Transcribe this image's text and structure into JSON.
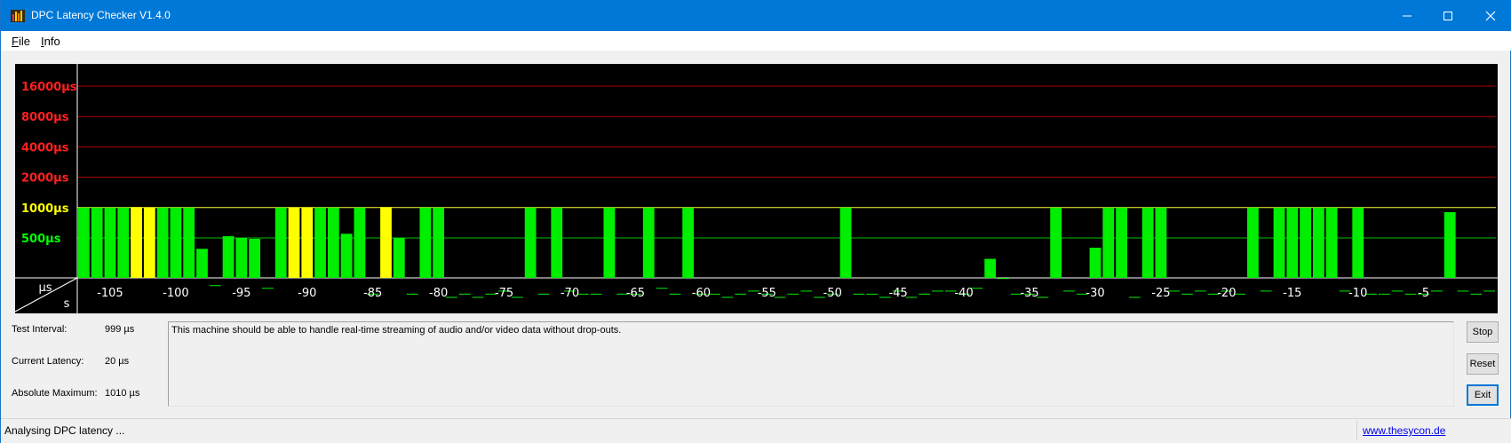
{
  "window": {
    "title": "DPC Latency Checker V1.4.0"
  },
  "menu": {
    "items": [
      {
        "label": "File",
        "accel": "F",
        "rest": "ile"
      },
      {
        "label": "Info",
        "accel": "I",
        "rest": "nfo"
      }
    ]
  },
  "chart_data": {
    "type": "bar",
    "y_scale": "log2",
    "y_ticks": [
      {
        "label": "16000µs",
        "value": 16000,
        "color": "#ff2020"
      },
      {
        "label": "8000µs",
        "value": 8000,
        "color": "#ff2020"
      },
      {
        "label": "4000µs",
        "value": 4000,
        "color": "#ff2020"
      },
      {
        "label": "2000µs",
        "value": 2000,
        "color": "#ff2020"
      },
      {
        "label": "1000µs",
        "value": 1000,
        "color": "#ffff00"
      },
      {
        "label": "500µs",
        "value": 500,
        "color": "#00ff00"
      }
    ],
    "x_label": "s",
    "y_unit_label": "µs",
    "x_ticks": [
      -105,
      -100,
      -95,
      -90,
      -85,
      -80,
      -75,
      -70,
      -65,
      -60,
      -55,
      -50,
      -45,
      -40,
      -35,
      -30,
      -25,
      -20,
      -15,
      -10,
      -5
    ],
    "x_range": [
      -107,
      0
    ],
    "colors": {
      "ok": "#00ee00",
      "warn": "#ffff00",
      "danger": "#ff2020",
      "grid_red": "#b00000",
      "grid_yellow": "#ffff40",
      "grid_green": "#00c000"
    },
    "bars": [
      {
        "t": -107,
        "v": 1000,
        "c": "ok"
      },
      {
        "t": -106,
        "v": 1000,
        "c": "ok"
      },
      {
        "t": -105,
        "v": 1000,
        "c": "ok"
      },
      {
        "t": -104,
        "v": 1000,
        "c": "ok"
      },
      {
        "t": -103,
        "v": 1010,
        "c": "warn"
      },
      {
        "t": -102,
        "v": 1005,
        "c": "warn"
      },
      {
        "t": -101,
        "v": 1000,
        "c": "ok"
      },
      {
        "t": -100,
        "v": 1000,
        "c": "ok"
      },
      {
        "t": -99,
        "v": 1000,
        "c": "ok"
      },
      {
        "t": -98,
        "v": 390,
        "c": "ok"
      },
      {
        "t": -97,
        "v": 170,
        "c": "ok"
      },
      {
        "t": -96,
        "v": 520,
        "c": "ok"
      },
      {
        "t": -95,
        "v": 500,
        "c": "ok"
      },
      {
        "t": -94,
        "v": 490,
        "c": "ok"
      },
      {
        "t": -93,
        "v": 160,
        "c": "ok"
      },
      {
        "t": -92,
        "v": 1000,
        "c": "ok"
      },
      {
        "t": -91,
        "v": 1005,
        "c": "warn"
      },
      {
        "t": -90,
        "v": 1005,
        "c": "warn"
      },
      {
        "t": -89,
        "v": 1000,
        "c": "ok"
      },
      {
        "t": -88,
        "v": 1000,
        "c": "ok"
      },
      {
        "t": -87,
        "v": 550,
        "c": "ok"
      },
      {
        "t": -86,
        "v": 1000,
        "c": "ok"
      },
      {
        "t": -85,
        "v": 140,
        "c": "ok"
      },
      {
        "t": -84,
        "v": 1010,
        "c": "warn"
      },
      {
        "t": -83,
        "v": 500,
        "c": "ok"
      },
      {
        "t": -82,
        "v": 140,
        "c": "ok"
      },
      {
        "t": -81,
        "v": 1000,
        "c": "ok"
      },
      {
        "t": -80,
        "v": 1000,
        "c": "ok"
      },
      {
        "t": -79,
        "v": 130,
        "c": "ok"
      },
      {
        "t": -78,
        "v": 140,
        "c": "ok"
      },
      {
        "t": -77,
        "v": 130,
        "c": "ok"
      },
      {
        "t": -76,
        "v": 140,
        "c": "ok"
      },
      {
        "t": -75,
        "v": 150,
        "c": "ok"
      },
      {
        "t": -74,
        "v": 130,
        "c": "ok"
      },
      {
        "t": -73,
        "v": 1000,
        "c": "ok"
      },
      {
        "t": -72,
        "v": 140,
        "c": "ok"
      },
      {
        "t": -71,
        "v": 1000,
        "c": "ok"
      },
      {
        "t": -70,
        "v": 150,
        "c": "ok"
      },
      {
        "t": -69,
        "v": 140,
        "c": "ok"
      },
      {
        "t": -68,
        "v": 140,
        "c": "ok"
      },
      {
        "t": -67,
        "v": 1000,
        "c": "ok"
      },
      {
        "t": -66,
        "v": 140,
        "c": "ok"
      },
      {
        "t": -65,
        "v": 140,
        "c": "ok"
      },
      {
        "t": -64,
        "v": 1000,
        "c": "ok"
      },
      {
        "t": -63,
        "v": 160,
        "c": "ok"
      },
      {
        "t": -62,
        "v": 140,
        "c": "ok"
      },
      {
        "t": -61,
        "v": 1000,
        "c": "ok"
      },
      {
        "t": -60,
        "v": 140,
        "c": "ok"
      },
      {
        "t": -59,
        "v": 140,
        "c": "ok"
      },
      {
        "t": -58,
        "v": 130,
        "c": "ok"
      },
      {
        "t": -57,
        "v": 140,
        "c": "ok"
      },
      {
        "t": -56,
        "v": 150,
        "c": "ok"
      },
      {
        "t": -55,
        "v": 140,
        "c": "ok"
      },
      {
        "t": -54,
        "v": 130,
        "c": "ok"
      },
      {
        "t": -53,
        "v": 140,
        "c": "ok"
      },
      {
        "t": -52,
        "v": 150,
        "c": "ok"
      },
      {
        "t": -51,
        "v": 130,
        "c": "ok"
      },
      {
        "t": -50,
        "v": 140,
        "c": "ok"
      },
      {
        "t": -49,
        "v": 1000,
        "c": "ok"
      },
      {
        "t": -48,
        "v": 140,
        "c": "ok"
      },
      {
        "t": -47,
        "v": 140,
        "c": "ok"
      },
      {
        "t": -46,
        "v": 130,
        "c": "ok"
      },
      {
        "t": -45,
        "v": 150,
        "c": "ok"
      },
      {
        "t": -44,
        "v": 130,
        "c": "ok"
      },
      {
        "t": -43,
        "v": 140,
        "c": "ok"
      },
      {
        "t": -42,
        "v": 150,
        "c": "ok"
      },
      {
        "t": -41,
        "v": 150,
        "c": "ok"
      },
      {
        "t": -40,
        "v": 140,
        "c": "ok"
      },
      {
        "t": -39,
        "v": 160,
        "c": "ok"
      },
      {
        "t": -38,
        "v": 310,
        "c": "ok"
      },
      {
        "t": -37,
        "v": 200,
        "c": "ok"
      },
      {
        "t": -36,
        "v": 140,
        "c": "ok"
      },
      {
        "t": -35,
        "v": 140,
        "c": "ok"
      },
      {
        "t": -34,
        "v": 130,
        "c": "ok"
      },
      {
        "t": -33,
        "v": 1000,
        "c": "ok"
      },
      {
        "t": -32,
        "v": 150,
        "c": "ok"
      },
      {
        "t": -31,
        "v": 140,
        "c": "ok"
      },
      {
        "t": -30,
        "v": 400,
        "c": "ok"
      },
      {
        "t": -29,
        "v": 1000,
        "c": "ok"
      },
      {
        "t": -28,
        "v": 1000,
        "c": "ok"
      },
      {
        "t": -27,
        "v": 130,
        "c": "ok"
      },
      {
        "t": -26,
        "v": 1000,
        "c": "ok"
      },
      {
        "t": -25,
        "v": 1000,
        "c": "ok"
      },
      {
        "t": -24,
        "v": 150,
        "c": "ok"
      },
      {
        "t": -23,
        "v": 140,
        "c": "ok"
      },
      {
        "t": -22,
        "v": 150,
        "c": "ok"
      },
      {
        "t": -21,
        "v": 140,
        "c": "ok"
      },
      {
        "t": -20,
        "v": 150,
        "c": "ok"
      },
      {
        "t": -19,
        "v": 140,
        "c": "ok"
      },
      {
        "t": -18,
        "v": 1000,
        "c": "ok"
      },
      {
        "t": -17,
        "v": 150,
        "c": "ok"
      },
      {
        "t": -16,
        "v": 1000,
        "c": "ok"
      },
      {
        "t": -15,
        "v": 1000,
        "c": "ok"
      },
      {
        "t": -14,
        "v": 1000,
        "c": "ok"
      },
      {
        "t": -13,
        "v": 1000,
        "c": "ok"
      },
      {
        "t": -12,
        "v": 1000,
        "c": "ok"
      },
      {
        "t": -11,
        "v": 150,
        "c": "ok"
      },
      {
        "t": -10,
        "v": 1000,
        "c": "ok"
      },
      {
        "t": -9,
        "v": 140,
        "c": "ok"
      },
      {
        "t": -8,
        "v": 140,
        "c": "ok"
      },
      {
        "t": -7,
        "v": 150,
        "c": "ok"
      },
      {
        "t": -6,
        "v": 140,
        "c": "ok"
      },
      {
        "t": -5,
        "v": 140,
        "c": "ok"
      },
      {
        "t": -4,
        "v": 150,
        "c": "ok"
      },
      {
        "t": -3,
        "v": 900,
        "c": "ok"
      },
      {
        "t": -2,
        "v": 150,
        "c": "ok"
      },
      {
        "t": -1,
        "v": 140,
        "c": "ok"
      },
      {
        "t": 0,
        "v": 150,
        "c": "ok"
      }
    ]
  },
  "info": {
    "test_interval_label": "Test Interval:",
    "test_interval_value": "999 µs",
    "current_latency_label": "Current Latency:",
    "current_latency_value": "20 µs",
    "absolute_max_label": "Absolute Maximum:",
    "absolute_max_value": "1010 µs"
  },
  "message": "This machine should be able to handle real-time streaming of audio and/or video data without drop-outs.",
  "buttons": {
    "stop": "Stop",
    "reset": "Reset",
    "exit": "Exit"
  },
  "status": {
    "text": "Analysing DPC latency ...",
    "link": "www.thesycon.de"
  }
}
